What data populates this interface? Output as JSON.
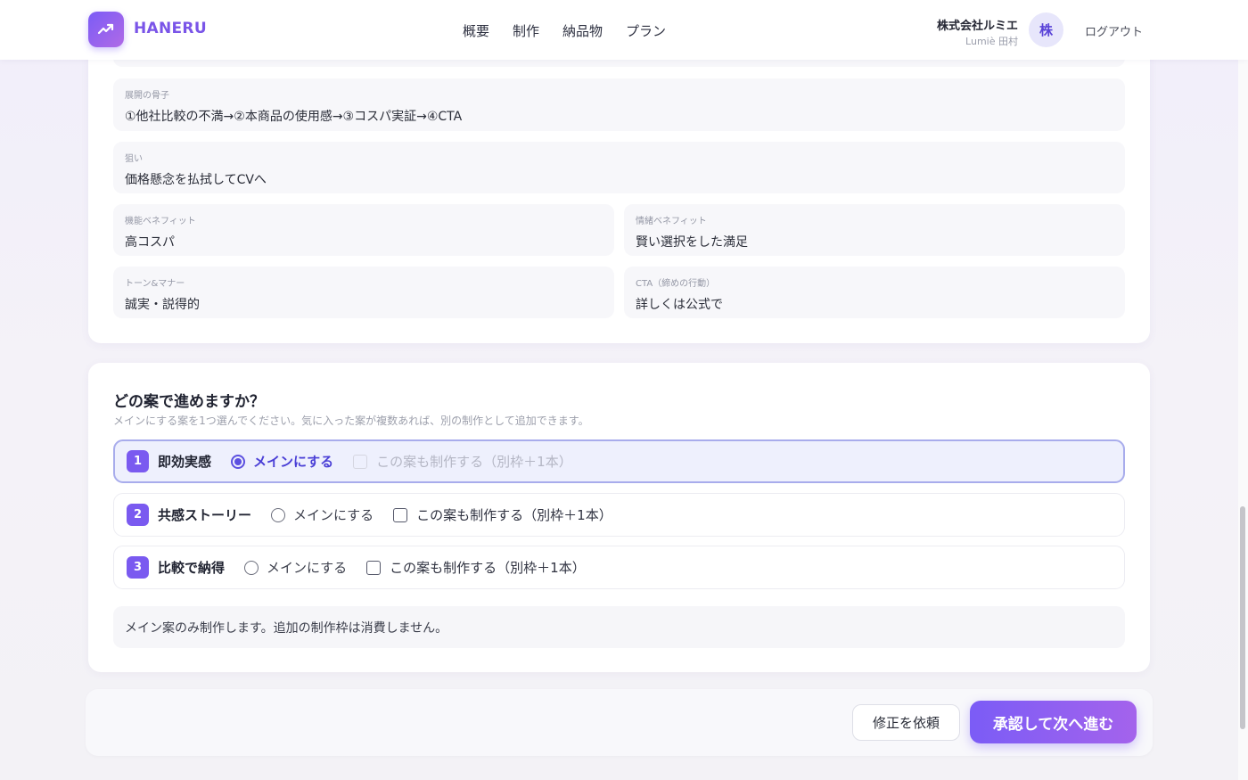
{
  "header": {
    "brand": "HANERU",
    "nav": [
      "概要",
      "制作",
      "納品物",
      "プラン"
    ],
    "company_name": "株式会社ルミエ",
    "user_name": "Lumiè 田村",
    "avatar_text": "株",
    "logout_label": "ログアウト"
  },
  "brief": {
    "structure": {
      "label": "展開の骨子",
      "value": "①他社比較の不満→②本商品の使用感→③コスパ実証→④CTA"
    },
    "aim": {
      "label": "狙い",
      "value": "価格懸念を払拭してCVへ"
    },
    "functional": {
      "label": "機能ベネフィット",
      "value": "高コスパ"
    },
    "emotional": {
      "label": "情緒ベネフィット",
      "value": "賢い選択をした満足"
    },
    "tone": {
      "label": "トーン&マナー",
      "value": "誠実・説得的"
    },
    "cta": {
      "label": "CTA（締めの行動）",
      "value": "詳しくは公式で"
    }
  },
  "selection": {
    "title": "どの案で進めますか？",
    "subtitle": "メインにする案を1つ選んでください。気に入った案が複数あれば、別の制作として追加できます。",
    "options": [
      {
        "num": "1",
        "name": "即効実感",
        "radio_label": "メインにする",
        "check_label": "この案も制作する（別枠＋1本）"
      },
      {
        "num": "2",
        "name": "共感ストーリー",
        "radio_label": "メインにする",
        "check_label": "この案も制作する（別枠＋1本）"
      },
      {
        "num": "3",
        "name": "比較で納得",
        "radio_label": "メインにする",
        "check_label": "この案も制作する（別枠＋1本）"
      }
    ],
    "notice": "メイン案のみ制作します。追加の制作枠は消費しません。"
  },
  "actions": {
    "revise_label": "修正を依頼",
    "approve_label": "承認して次へ進む"
  },
  "colors": {
    "accent": "#7b5cf6",
    "selected_bg": "#eef0fd"
  }
}
